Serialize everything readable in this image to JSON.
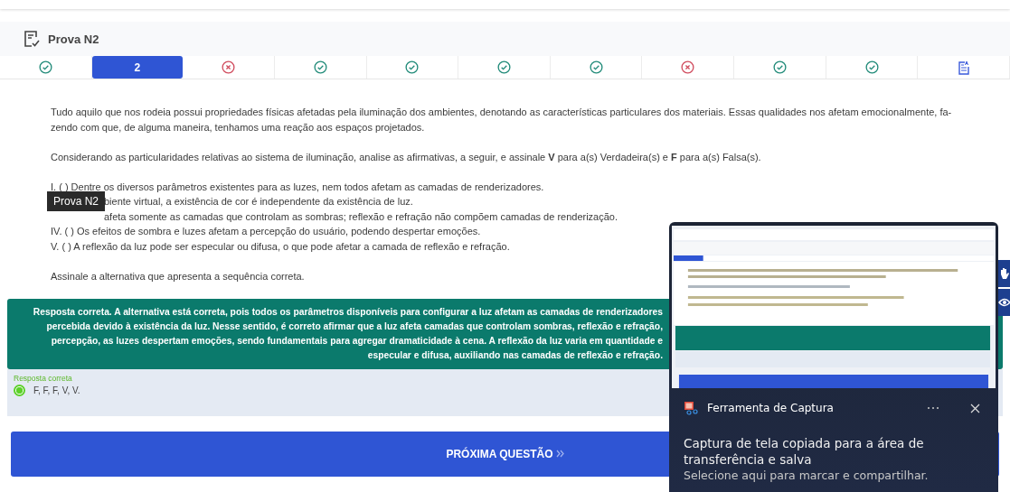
{
  "header": {
    "title": "Prova N2"
  },
  "questions": [
    {
      "kind": "correct",
      "selected": false
    },
    {
      "kind": "current",
      "label": "2",
      "selected": true
    },
    {
      "kind": "wrong",
      "selected": false
    },
    {
      "kind": "correct",
      "selected": false
    },
    {
      "kind": "correct",
      "selected": false
    },
    {
      "kind": "correct",
      "selected": false
    },
    {
      "kind": "correct",
      "selected": false
    },
    {
      "kind": "wrong",
      "selected": false
    },
    {
      "kind": "correct",
      "selected": false
    },
    {
      "kind": "correct",
      "selected": false
    },
    {
      "kind": "report",
      "selected": false
    }
  ],
  "question": {
    "intro_lines": [
      "Tudo aquilo que nos rodeia possui propriedades físicas afetadas pela iluminação dos ambientes, denotando as características particulares dos materiais. Essas qualidades nos afetam emocionalmente, fa-",
      "zendo com que, de alguma maneira, tenhamos uma reação aos espaços projetados."
    ],
    "instruction": "Considerando as particularidades relativas ao sistema de iluminação, analise as afirmativas, a seguir, e assinale **V** para a(s) Verdadeira(s) e **F** para a(s) Falsa(s).",
    "statements": [
      {
        "text": "I. (  ) Dentre os diversos parâmetros existentes para as luzes, nem todos afetam as camadas de renderizadores.",
        "kind": "full"
      },
      {
        "text": "biente virtual, a existência de cor é independente da existência de luz.",
        "kind": "partial"
      },
      {
        "text": "afeta somente as camadas que controlam as sombras; reflexão e refração não compõem camadas de renderização.",
        "kind": "partial"
      },
      {
        "text": "IV. (  ) Os efeitos de sombra e luzes afetam a percepção do usuário, podendo despertar emoções.",
        "kind": "full"
      },
      {
        "text": "V. (  ) A reflexão da luz pode ser especular ou difusa, o que pode afetar a camada de reflexão e refração.",
        "kind": "full"
      }
    ],
    "prompt": "Assinale a alternativa que apresenta a sequência correta."
  },
  "tooltip": "Prova N2",
  "feedback": {
    "lines": [
      "Resposta correta. A alternativa está correta, pois todos os parâmetros disponíveis para configurar a luz afetam as camadas de renderizadores",
      "percebida devido à existência da luz. Nesse sentido, é correto afirmar que a luz afeta camadas que controlam sombras, reflexão e refração,",
      "percepção, as luzes despertam emoções, sendo fundamentais para agregar dramaticidade à cena. A reflexão da luz varia em quantidade e",
      "especular e difusa, auxiliando nas camadas de reflexão e refração."
    ]
  },
  "answer": {
    "label": "Resposta correta",
    "option": "F, F, F, V, V.",
    "selected": true
  },
  "next_button": {
    "label": "PRÓXIMA QUESTÃO"
  },
  "notification": {
    "app": "Ferramenta de Captura",
    "message": "Captura de tela copiada para a área de transferência e salva",
    "hint": "Selecione aqui para marcar e compartilhar."
  }
}
